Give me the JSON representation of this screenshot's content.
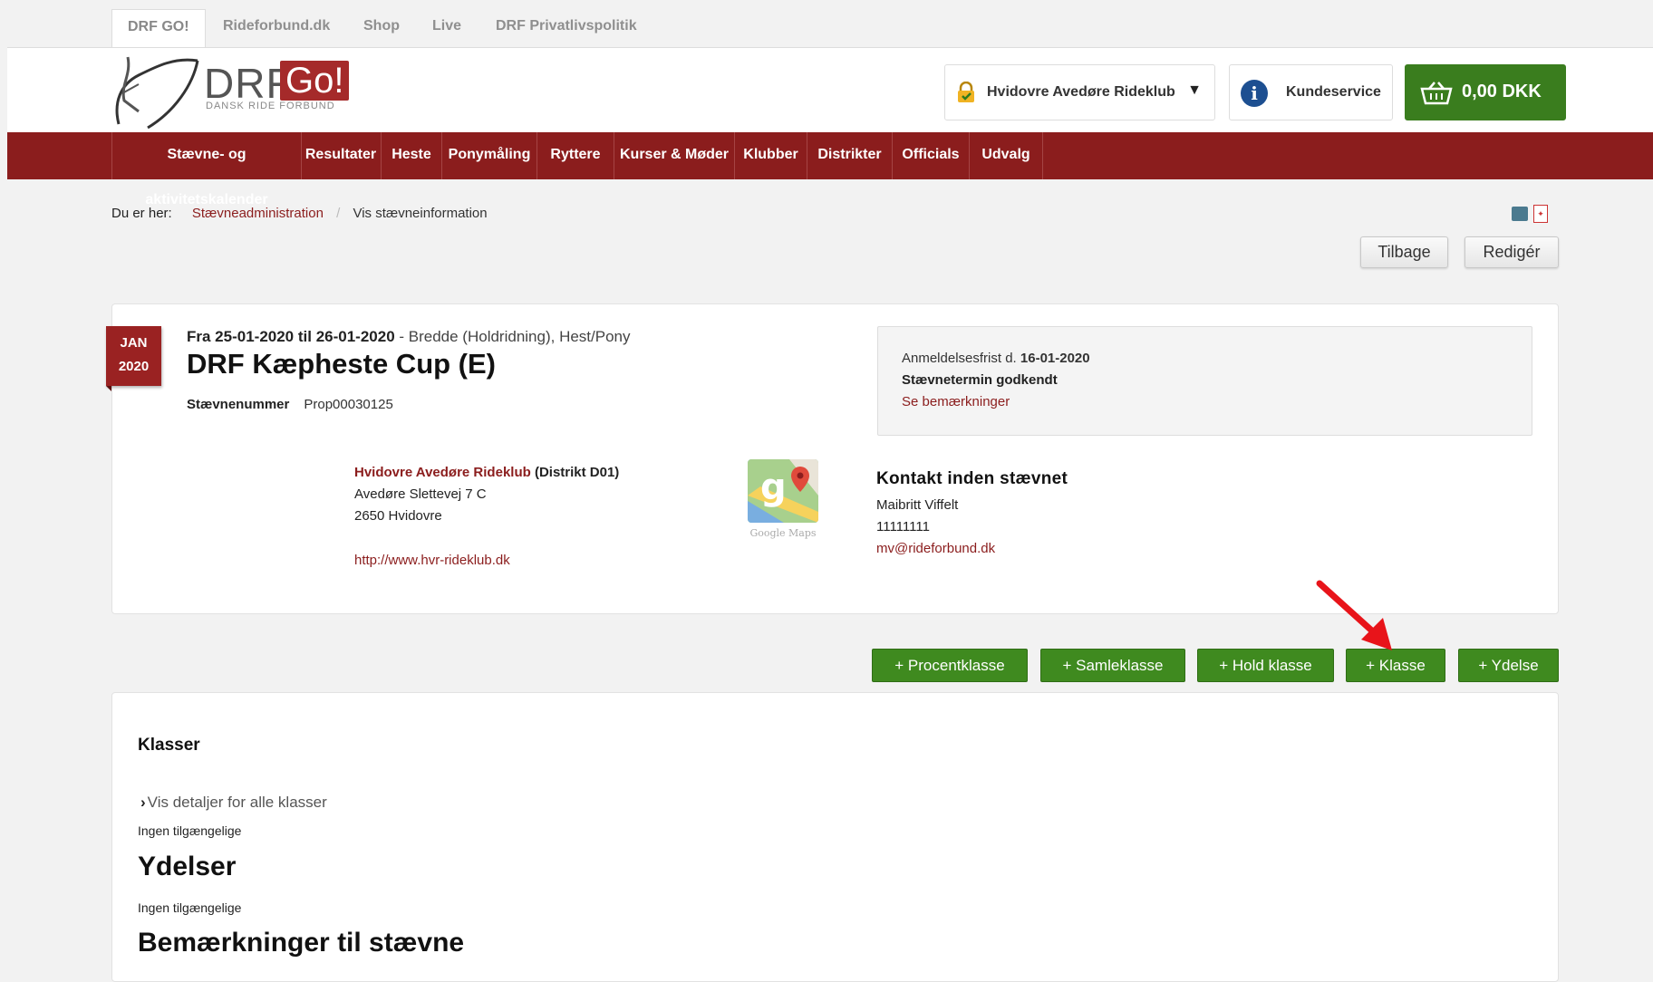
{
  "top_tabs": [
    "DRF GO!",
    "Rideforbund.dk",
    "Shop",
    "Live",
    "DRF Privatlivspolitik"
  ],
  "logo": {
    "drf": "DRF",
    "go": "Go!",
    "sub": "DANSK RIDE FORBUND"
  },
  "header": {
    "club": "Hvidovre Avedøre Rideklub",
    "customer_service": "Kundeservice",
    "cart_total": "0,00 DKK"
  },
  "nav": [
    "Stævne- og aktivitetskalender",
    "Resultater",
    "Heste",
    "Ponymåling",
    "Ryttere",
    "Kurser & Møder",
    "Klubber",
    "Distrikter",
    "Officials",
    "Udvalg"
  ],
  "breadcrumb": {
    "label": "Du er her:",
    "link": "Stævneadministration",
    "sep": "/",
    "current": "Vis stævneinformation"
  },
  "buttons": {
    "back": "Tilbage",
    "edit": "Redigér"
  },
  "event": {
    "month": "JAN",
    "year": "2020",
    "date_range": "Fra 25-01-2020 til 26-01-2020",
    "details": " - Bredde (Holdridning), Hest/Pony",
    "title": "DRF Kæpheste Cup (E)",
    "number_label": "Stævnenummer",
    "number": "Prop00030125"
  },
  "status": {
    "deadline_label": "Anmeldelsesfrist d. ",
    "deadline": "16-01-2020",
    "approved": "Stævnetermin godkendt",
    "remarks_link": "Se bemærkninger"
  },
  "venue": {
    "club": "Hvidovre Avedøre Rideklub",
    "district": " (Distrikt D01)",
    "street": "Avedøre Slettevej 7 C",
    "city": "2650 Hvidovre",
    "url": "http://www.hvr-rideklub.dk",
    "maps_label": "Google Maps"
  },
  "contact": {
    "heading": "Kontakt inden stævnet",
    "name": "Maibritt Viffelt",
    "phone": "11111111",
    "email": "mv@rideforbund.dk"
  },
  "actions": [
    "+ Procentklasse",
    "+ Samleklasse",
    "+ Hold klasse",
    "+ Klasse",
    "+ Ydelse"
  ],
  "classes": {
    "heading": "Klasser",
    "show_details": "Vis detaljer for alle klasser",
    "none1": "Ingen tilgængelige",
    "services_heading": "Ydelser",
    "none2": "Ingen tilgængelige",
    "remarks_heading": "Bemærkninger til stævne"
  },
  "colors": {
    "brand_red": "#8b1d1d",
    "green": "#3f8a1f",
    "annotation_arrow": "#e8141a"
  }
}
